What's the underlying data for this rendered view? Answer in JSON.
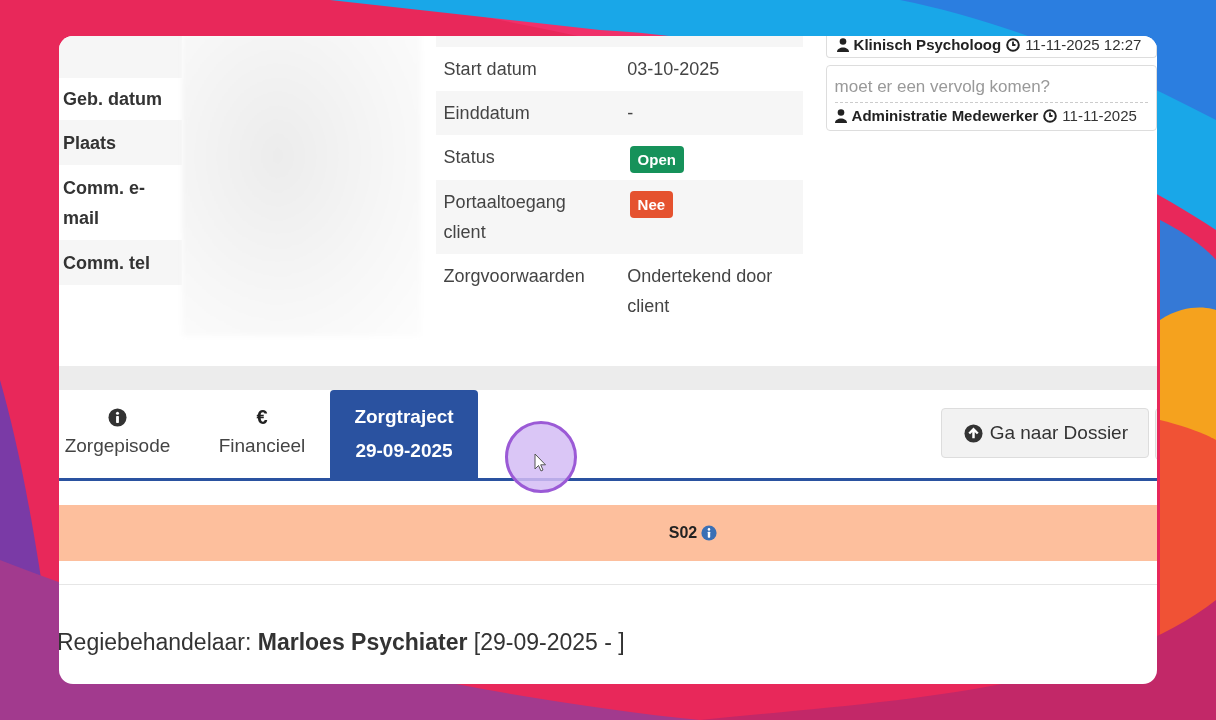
{
  "patient_fields": [
    {
      "label": "Geb. datum"
    },
    {
      "label": "Plaats"
    },
    {
      "label": "Comm. e-mail"
    },
    {
      "label": "Comm. tel"
    }
  ],
  "details": [
    {
      "label": "Start datum",
      "value": "03-10-2025"
    },
    {
      "label": "Einddatum",
      "value": "-"
    },
    {
      "label": "Status",
      "badge": {
        "text": "Open",
        "color": "#16925a"
      }
    },
    {
      "label": "Portaaltoegang client",
      "badge": {
        "text": "Nee",
        "color": "#e5522f"
      }
    },
    {
      "label": "Zorgvoorwaarden",
      "value": "Ondertekend door client"
    }
  ],
  "notes": [
    {
      "author": "Klinisch Psycholoog",
      "time": "11-11-2025 12:27"
    },
    {
      "text": "moet er een vervolg komen?",
      "author": "Administratie Medewerker",
      "time": "11-11-2025"
    }
  ],
  "tabs": [
    {
      "kind": "info",
      "label": "Zorgepisode",
      "selected": false
    },
    {
      "kind": "glyph",
      "glyph": "€",
      "label": "Financieel",
      "selected": false
    },
    {
      "kind": "plain",
      "label": "Zorgtraject",
      "sublabel": "29-09-2025",
      "selected": true
    }
  ],
  "actions": [
    {
      "label": "Ga naar Dossier"
    }
  ],
  "segment_bar": {
    "code": "S02"
  },
  "regiebehandelaar": "Regiebehandelaar: **Marloes Psychiater** [29-09-2025 - ]"
}
